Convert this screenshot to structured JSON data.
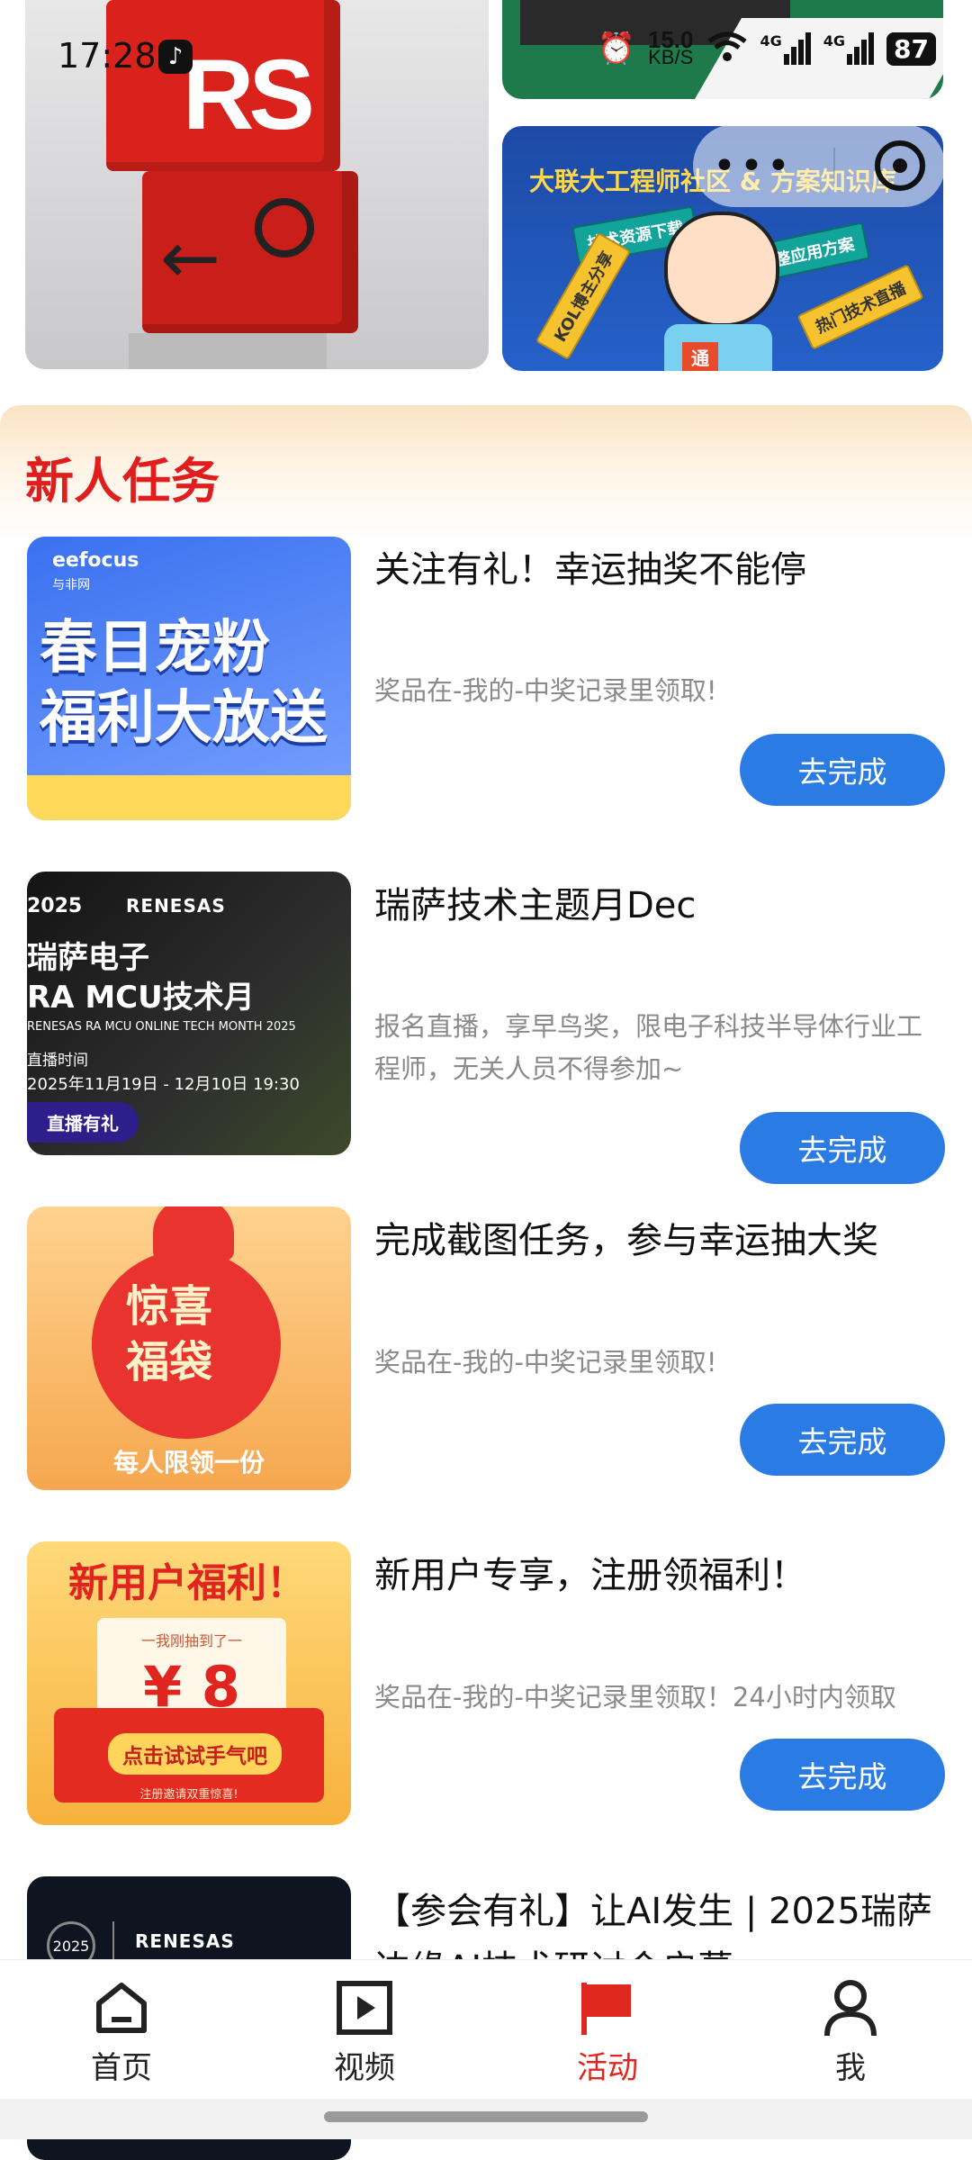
{
  "status_bar": {
    "time": "17:28",
    "net_speed_value": "15.0",
    "net_speed_unit": "KB/S",
    "signal_1": "4G",
    "signal_2": "4G",
    "battery": "87"
  },
  "banners": {
    "left_logo": "RS",
    "right_headline": "大联大工程师社区 & 方案知识库",
    "right_tags": [
      "技术资源下载",
      "完整应用方案",
      "KOL博主分享",
      "热门技术直播"
    ],
    "right_badge": "通"
  },
  "section": {
    "title": "新人任务"
  },
  "tasks": [
    {
      "title": "关注有礼！幸运抽奖不能停",
      "desc": "奖品在-我的-中奖记录里领取!",
      "button": "去完成",
      "thumb_logo": "eefocus",
      "thumb_sub": "与非网",
      "thumb_line1": "春日宠粉",
      "thumb_line2": "福利大放送"
    },
    {
      "title": "瑞萨技术主题月Dec",
      "desc": "报名直播，享早鸟奖，限电子科技半导体行业工程师，无关人员不得参加~",
      "button": "去完成",
      "thumb_year": "2025",
      "thumb_brand": "RENESAS",
      "thumb_line1": "瑞萨电子",
      "thumb_line2": "RA MCU技术月",
      "thumb_line3": "RENESAS RA MCU ONLINE TECH MONTH 2025",
      "thumb_line4": "直播时间",
      "thumb_line5": "2025年11月19日 - 12月10日  19:30",
      "thumb_pill": "直播有礼"
    },
    {
      "title": "完成截图任务，参与幸运抽大奖",
      "desc": "奖品在-我的-中奖记录里领取!",
      "button": "去完成",
      "thumb_line1": "惊喜",
      "thumb_line2": "福袋",
      "thumb_line3": "每人限领一份"
    },
    {
      "title": "新用户专享，注册领福利！",
      "desc": "奖品在-我的-中奖记录里领取！24小时内领取",
      "button": "去完成",
      "thumb_head": "新用户福利！",
      "thumb_sub": "一我刚抽到了一",
      "thumb_amount": "¥ 8",
      "thumb_cta": "点击试试手气吧",
      "thumb_small": "注册邀请双重惊喜!"
    },
    {
      "title": "【参会有礼】让AI发生 | 2025瑞萨",
      "title2": "边缘AI技术研讨会启幕",
      "thumb_year": "2025",
      "thumb_brand": "RENESAS"
    }
  ],
  "nav": {
    "items": [
      {
        "label": "首页",
        "icon": "home-icon"
      },
      {
        "label": "视频",
        "icon": "video-icon"
      },
      {
        "label": "活动",
        "icon": "flag-icon"
      },
      {
        "label": "我",
        "icon": "person-icon"
      }
    ],
    "active_color": "#e0271f"
  },
  "colors": {
    "accent_blue": "#2a7be4",
    "title_red": "#e01e1e"
  }
}
